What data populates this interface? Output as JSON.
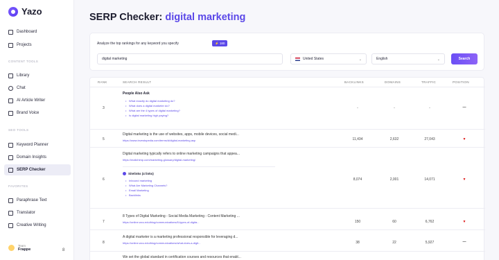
{
  "brand": {
    "name": "Yazo"
  },
  "sidebar": {
    "top_items": [
      {
        "label": "Dashboard",
        "icon": "dashboard-icon"
      },
      {
        "label": "Projects",
        "icon": "projects-icon"
      }
    ],
    "content_tools": {
      "heading": "CONTENT TOOLS",
      "items": [
        {
          "label": "Library",
          "icon": "library-icon"
        },
        {
          "label": "Chat",
          "icon": "chat-icon"
        },
        {
          "label": "AI Article Writer",
          "icon": "article-writer-icon"
        },
        {
          "label": "Brand Voice",
          "icon": "megaphone-icon"
        }
      ]
    },
    "seo_tools": {
      "heading": "SEO TOOLS",
      "items": [
        {
          "label": "Keyword Planner",
          "icon": "keyword-icon"
        },
        {
          "label": "Domain Insights",
          "icon": "chart-icon"
        },
        {
          "label": "SERP Checker",
          "icon": "serp-icon",
          "active": true
        }
      ]
    },
    "favorites": {
      "heading": "FAVORITES",
      "items": [
        {
          "label": "Paraphrase Text",
          "icon": "paraphrase-icon"
        },
        {
          "label": "Translator",
          "icon": "translator-icon"
        },
        {
          "label": "Creative Writing",
          "icon": "writing-icon"
        }
      ]
    },
    "footer": {
      "team_label": "Team",
      "team_name": "Frappe",
      "badge": "8"
    }
  },
  "header": {
    "title_prefix": "SERP Checker:",
    "keyword": "digital marketing"
  },
  "search_card": {
    "label": "Analyze the top rankings for any keyword you specify",
    "credits": "⚡ 180",
    "keyword_value": "digital marketing",
    "country": "United States",
    "language": "English",
    "search_button": "Search"
  },
  "table": {
    "headers": {
      "rank": "RANK",
      "result": "SEARCH RESULT",
      "backlinks": "BACKLINKS",
      "domains": "DOMAINS",
      "traffic": "TRAFFIC",
      "position": "POSITION"
    },
    "paa": {
      "rank": "3",
      "title": "People Also Ask",
      "questions": [
        "What exactly do digital marketing do?",
        "What does a digital marketer do?",
        "What are the 4 types of digital marketing?",
        "Is digital marketing high paying?"
      ],
      "backlinks": "-",
      "domains": "-",
      "traffic": "-",
      "position": "—"
    },
    "rows": [
      {
        "rank": "5",
        "title": "Digital marketing is the use of websites, apps, mobile devices, social medi...",
        "url": "https://www.investopedia.com/terms/d/digital-marketing.asp",
        "backlinks": "11,434",
        "domains": "2,632",
        "traffic": "27,043",
        "position": "▼"
      },
      {
        "rank": "6",
        "title": "Digital marketing typically refers to online marketing campaigns that appea...",
        "url": "https://mailchimp.com/marketing-glossary/digital-marketing/",
        "sitelinks_heading": "Sitelinks (4 links)",
        "sitelinks": [
          "Inbound marketing",
          "What Are Marketing Channels?",
          "Email Marketing",
          "Backlinks"
        ],
        "backlinks": "8,074",
        "domains": "2,001",
        "traffic": "14,071",
        "position": "▼"
      },
      {
        "rank": "7",
        "title": "8 Types of Digital Marketing - Social Media Marketing - Content Marketing ...",
        "url": "https://online.wcu.edu/blog/communications/8-types-of-digita...",
        "backlinks": "150",
        "domains": "60",
        "traffic": "6,762",
        "position": "▼"
      },
      {
        "rank": "8",
        "title": "A digital marketer is a marketing professional responsible for leveraging d...",
        "url": "https://online.wcu.edu/blog/communications/what-does-a-digit...",
        "backlinks": "38",
        "domains": "22",
        "traffic": "5,927",
        "position": "—"
      },
      {
        "title": "We set the global standard in certification courses and resources that enabl..."
      }
    ]
  },
  "colors": {
    "accent": "#5b48e8",
    "down": "#d11111"
  }
}
